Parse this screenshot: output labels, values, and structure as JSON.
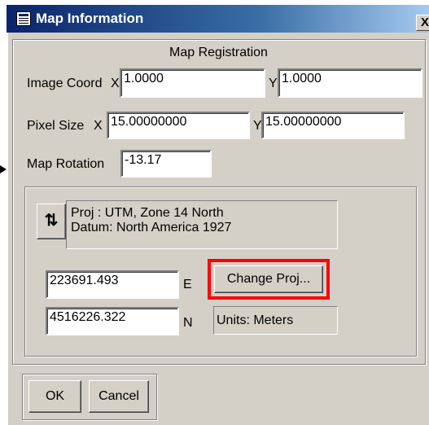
{
  "window": {
    "title": "Map Information",
    "close_label": "X"
  },
  "registration": {
    "heading": "Map Registration",
    "image_coord_label": "Image Coord",
    "x_label": "X",
    "y_label": "Y",
    "image_coord_x": "1.0000",
    "image_coord_y": "1.0000",
    "pixel_size_label": "Pixel Size",
    "pixel_size_x": "15.00000000",
    "pixel_size_y": "15.00000000",
    "rotation_label": "Map Rotation",
    "rotation_value": "-13.17"
  },
  "projection": {
    "swap_glyph": "⇅",
    "proj_line": "Proj : UTM, Zone 14 North",
    "datum_line": "Datum: North America 1927",
    "easting": "223691.493",
    "easting_label": "E",
    "northing": "4516226.322",
    "northing_label": "N",
    "change_proj_label": "Change Proj...",
    "units_label": "Units: Meters",
    "highlight_color": "#ff0000"
  },
  "actions": {
    "ok_label": "OK",
    "cancel_label": "Cancel"
  }
}
